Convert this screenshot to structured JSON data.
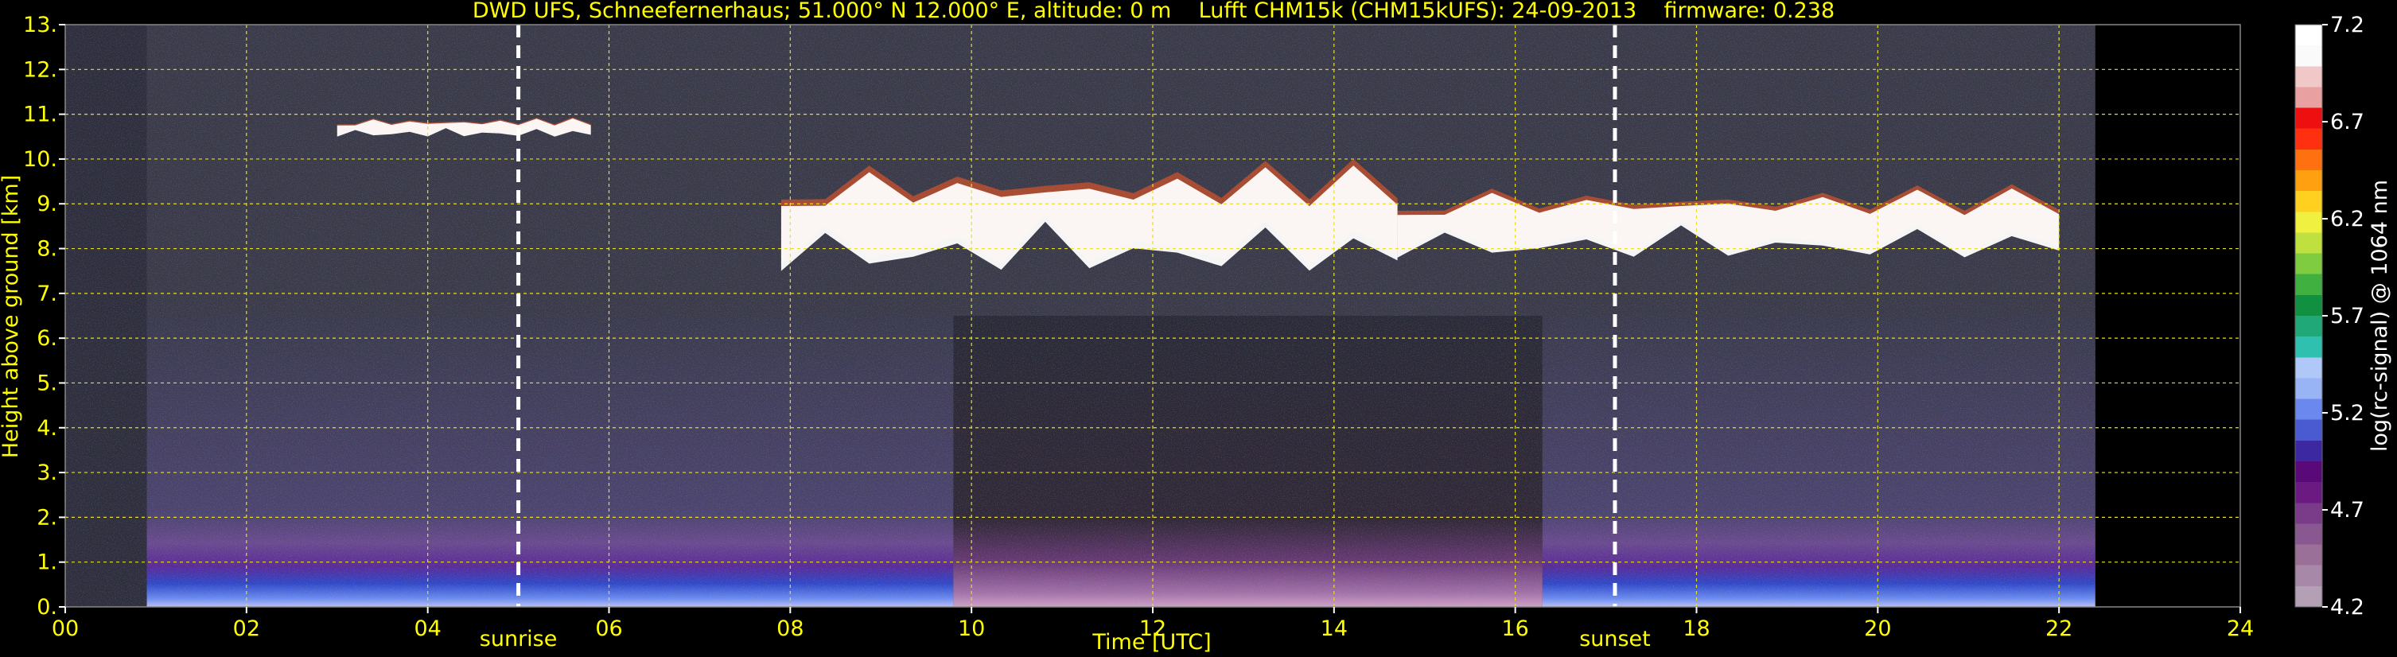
{
  "chart_data": {
    "type": "heatmap",
    "title": "DWD UFS, Schneefernerhaus; 51.000° N 12.000° E, altitude: 0 m    Lufft CHM15k (CHM15kUFS): 24-09-2013    firmware: 0.238",
    "xlabel": "Time [UTC]",
    "ylabel": "Height above ground [km]",
    "xlim": [
      0,
      24
    ],
    "ylim": [
      0,
      13
    ],
    "x_ticks": [
      "00",
      "02",
      "04",
      "06",
      "08",
      "10",
      "12",
      "14",
      "16",
      "18",
      "20",
      "22",
      "24"
    ],
    "y_ticks": [
      "0.",
      "1.",
      "2.",
      "3.",
      "4.",
      "5.",
      "6.",
      "7.",
      "8.",
      "9.",
      "10.",
      "11.",
      "12.",
      "13."
    ],
    "grid": true,
    "data_end_hour": 22.4,
    "markers": [
      {
        "label": "sunrise",
        "x": 5.0
      },
      {
        "label": "sunset",
        "x": 17.1
      }
    ],
    "colorbar": {
      "label": "log(rc-signal) @ 1064 nm",
      "ticks": [
        "4.2",
        "4.7",
        "5.2",
        "5.7",
        "6.2",
        "6.7",
        "7.2"
      ],
      "range": [
        4.2,
        7.2
      ],
      "colors": [
        "#b4a0b4",
        "#a888a8",
        "#9a7098",
        "#8a5890",
        "#7a3c88",
        "#6a1a80",
        "#5a0a78",
        "#3c28a0",
        "#4a5ad0",
        "#6a88ee",
        "#98b4f4",
        "#b0c8f8",
        "#30c0b0",
        "#20a878",
        "#109040",
        "#40b040",
        "#80cc40",
        "#c0e040",
        "#f0f040",
        "#ffd020",
        "#ffa010",
        "#ff7010",
        "#ff3010",
        "#ee1010",
        "#e8a0a0",
        "#f0c8c8",
        "#fafafa",
        "#ffffff"
      ]
    },
    "cloud_layers": [
      {
        "t_start": 3.0,
        "t_end": 5.8,
        "z_low": 10.5,
        "z_high": 11.0
      },
      {
        "t_start": 7.9,
        "t_end": 14.7,
        "z_low": 7.5,
        "z_high": 10.4
      },
      {
        "t_start": 14.7,
        "t_end": 22.0,
        "z_low": 7.8,
        "z_high": 9.7
      }
    ],
    "boundary_layer": [
      {
        "t_start": 0.9,
        "t_end": 9.8,
        "z_top": 2.5
      },
      {
        "t_start": 9.8,
        "t_end": 16.3,
        "z_top": 3.5
      },
      {
        "t_start": 16.3,
        "t_end": 22.4,
        "z_top": 3.0
      }
    ]
  }
}
